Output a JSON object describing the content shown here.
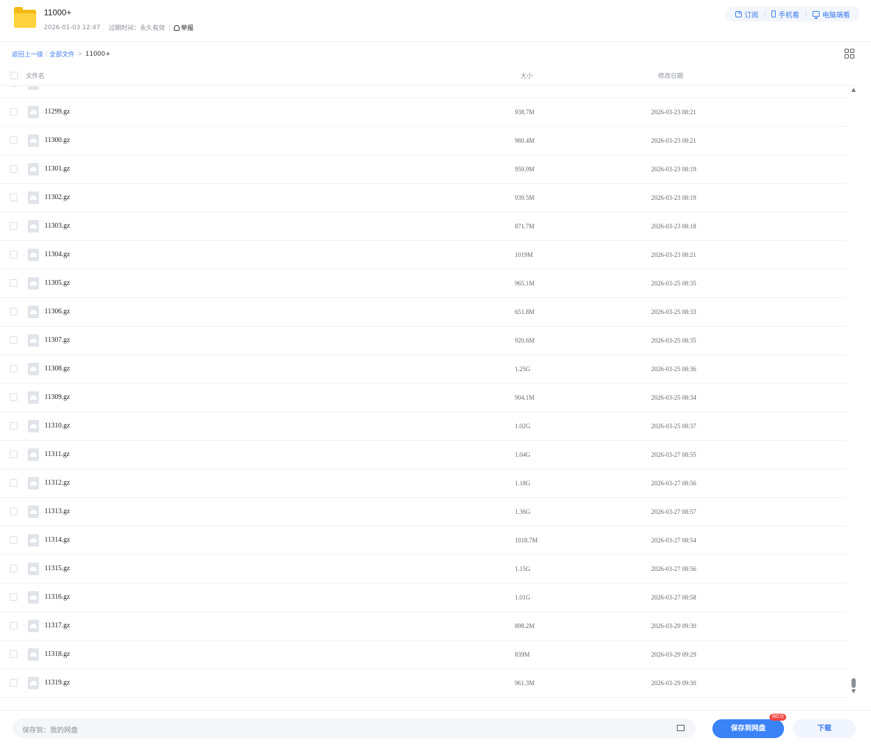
{
  "header": {
    "title": "11000+",
    "date": "2026-01-03 12:47",
    "expire": "过期时间：永久有效",
    "report": "举报",
    "actions": {
      "subscribe": "订阅",
      "phone": "手机看",
      "pc": "电脑端看"
    }
  },
  "breadcrumb": {
    "back": "返回上一级",
    "all": "全部文件",
    "current": "11000+"
  },
  "columns": {
    "name": "文件名",
    "size": "大小",
    "date": "修改日期"
  },
  "files": [
    {
      "name": "11299.gz",
      "size": "938.7M",
      "date": "2026-03-23 08:21"
    },
    {
      "name": "11300.gz",
      "size": "980.4M",
      "date": "2026-03-23 08:21"
    },
    {
      "name": "11301.gz",
      "size": "959.9M",
      "date": "2026-03-23 08:19"
    },
    {
      "name": "11302.gz",
      "size": "939.5M",
      "date": "2026-03-23 08:19"
    },
    {
      "name": "11303.gz",
      "size": "871.7M",
      "date": "2026-03-23 08:18"
    },
    {
      "name": "11304.gz",
      "size": "1019M",
      "date": "2026-03-23 08:21"
    },
    {
      "name": "11305.gz",
      "size": "965.1M",
      "date": "2026-03-25 08:35"
    },
    {
      "name": "11306.gz",
      "size": "651.8M",
      "date": "2026-03-25 08:33"
    },
    {
      "name": "11307.gz",
      "size": "920.6M",
      "date": "2026-03-25 08:35"
    },
    {
      "name": "11308.gz",
      "size": "1.25G",
      "date": "2026-03-25 08:36"
    },
    {
      "name": "11309.gz",
      "size": "904.1M",
      "date": "2026-03-25 08:34"
    },
    {
      "name": "11310.gz",
      "size": "1.02G",
      "date": "2026-03-25 08:37"
    },
    {
      "name": "11311.gz",
      "size": "1.04G",
      "date": "2026-03-27 08:55"
    },
    {
      "name": "11312.gz",
      "size": "1.18G",
      "date": "2026-03-27 08:56"
    },
    {
      "name": "11313.gz",
      "size": "1.36G",
      "date": "2026-03-27 08:57"
    },
    {
      "name": "11314.gz",
      "size": "1018.7M",
      "date": "2026-03-27 08:54"
    },
    {
      "name": "11315.gz",
      "size": "1.15G",
      "date": "2026-03-27 08:56"
    },
    {
      "name": "11316.gz",
      "size": "1.01G",
      "date": "2026-03-27 08:58"
    },
    {
      "name": "11317.gz",
      "size": "898.2M",
      "date": "2026-03-29 09:30"
    },
    {
      "name": "11318.gz",
      "size": "839M",
      "date": "2026-03-29 09:29"
    },
    {
      "name": "11319.gz",
      "size": "961.3M",
      "date": "2026-03-29 09:30"
    }
  ],
  "footer": {
    "save_to": "保存到：我的网盘",
    "save_button": "保存到网盘",
    "badge": "领红包",
    "download": "下载"
  },
  "colors": {
    "accent": "#3a82f6",
    "folder": "#ffd23e",
    "badge": "#f0443e"
  }
}
